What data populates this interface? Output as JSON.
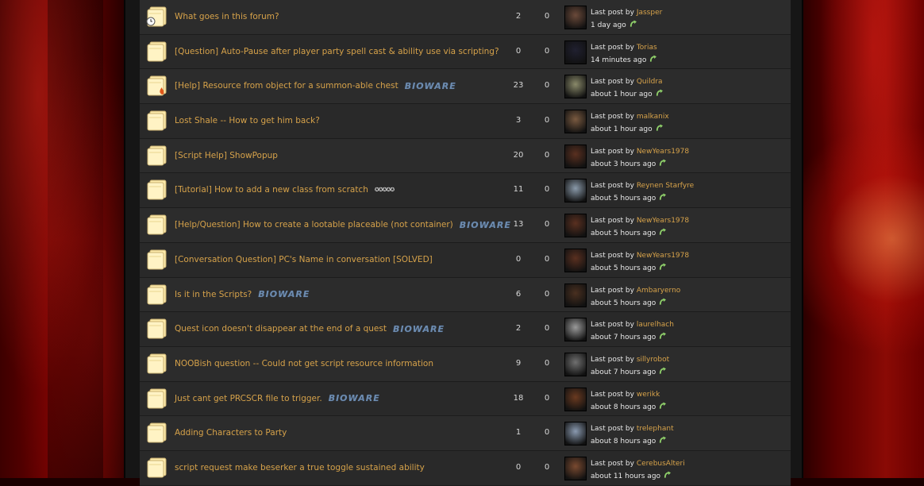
{
  "last_post_prefix": "Last post by",
  "topics": [
    {
      "title": "What goes in this forum?",
      "bioware": false,
      "stars": false,
      "replies": "2",
      "views": "0",
      "last_user": "Jassper",
      "last_time": "1 day ago",
      "folder_mark": "pin",
      "avatar_color": "#6b4a3a"
    },
    {
      "title": "[Question] Auto-Pause after player party spell cast & ability use via scripting?",
      "bioware": false,
      "stars": false,
      "replies": "0",
      "views": "0",
      "last_user": "Torias",
      "last_time": "14 minutes ago",
      "folder_mark": "",
      "avatar_color": "#202030"
    },
    {
      "title": "[Help] Resource from object for a summon-able chest",
      "bioware": true,
      "stars": false,
      "replies": "23",
      "views": "0",
      "last_user": "Quildra",
      "last_time": "about 1 hour ago",
      "folder_mark": "hot",
      "avatar_color": "#8a8a6a"
    },
    {
      "title": "Lost Shale -- How to get him back?",
      "bioware": false,
      "stars": false,
      "replies": "3",
      "views": "0",
      "last_user": "malkanix",
      "last_time": "about 1 hour ago",
      "folder_mark": "",
      "avatar_color": "#7a5a40"
    },
    {
      "title": "[Script Help] ShowPopup",
      "bioware": false,
      "stars": false,
      "replies": "20",
      "views": "0",
      "last_user": "NewYears1978",
      "last_time": "about 3 hours ago",
      "folder_mark": "",
      "avatar_color": "#5a3020"
    },
    {
      "title": "[Tutorial] How to add a new class from scratch",
      "bioware": false,
      "stars": true,
      "replies": "11",
      "views": "0",
      "last_user": "Reynen Starfyre",
      "last_time": "about 5 hours ago",
      "folder_mark": "",
      "avatar_color": "#8a9aaa"
    },
    {
      "title": "[Help/Question] How to create a lootable placeable (not container)",
      "bioware": true,
      "stars": false,
      "replies": "13",
      "views": "0",
      "last_user": "NewYears1978",
      "last_time": "about 5 hours ago",
      "folder_mark": "",
      "avatar_color": "#5a3020"
    },
    {
      "title": "[Conversation Question] PC's Name in conversation [SOLVED]",
      "bioware": false,
      "stars": false,
      "replies": "0",
      "views": "0",
      "last_user": "NewYears1978",
      "last_time": "about 5 hours ago",
      "folder_mark": "",
      "avatar_color": "#5a3020"
    },
    {
      "title": "Is it in the Scripts?",
      "bioware": true,
      "stars": false,
      "replies": "6",
      "views": "0",
      "last_user": "Ambaryerno",
      "last_time": "about 5 hours ago",
      "folder_mark": "",
      "avatar_color": "#4a3020"
    },
    {
      "title": "Quest icon doesn't disappear at the end of a quest",
      "bioware": true,
      "stars": false,
      "replies": "2",
      "views": "0",
      "last_user": "laurelhach",
      "last_time": "about 7 hours ago",
      "folder_mark": "",
      "avatar_color": "#9a9a9a"
    },
    {
      "title": "NOOBish question -- Could not get script resource information",
      "bioware": false,
      "stars": false,
      "replies": "9",
      "views": "0",
      "last_user": "sillyrobot",
      "last_time": "about 7 hours ago",
      "folder_mark": "",
      "avatar_color": "#707070"
    },
    {
      "title": "Just cant get PRCSCR file to trigger.",
      "bioware": true,
      "stars": false,
      "replies": "18",
      "views": "0",
      "last_user": "werikk",
      "last_time": "about 8 hours ago",
      "folder_mark": "",
      "avatar_color": "#6a3a20"
    },
    {
      "title": "Adding Characters to Party",
      "bioware": false,
      "stars": false,
      "replies": "1",
      "views": "0",
      "last_user": "trelephant",
      "last_time": "about 8 hours ago",
      "folder_mark": "",
      "avatar_color": "#8a9ab0"
    },
    {
      "title": "script request make beserker a true toggle sustained ability",
      "bioware": false,
      "stars": false,
      "replies": "0",
      "views": "0",
      "last_user": "CerebusAlteri",
      "last_time": "about 11 hours ago",
      "folder_mark": "",
      "avatar_color": "#7a4a30"
    }
  ],
  "bioware_badge": "BIOWARE",
  "stars_glyph": "✪✪✪✪✪",
  "icons": {
    "folder": "folder-icon",
    "last_post_arrow": "go-to-last-post-icon"
  }
}
